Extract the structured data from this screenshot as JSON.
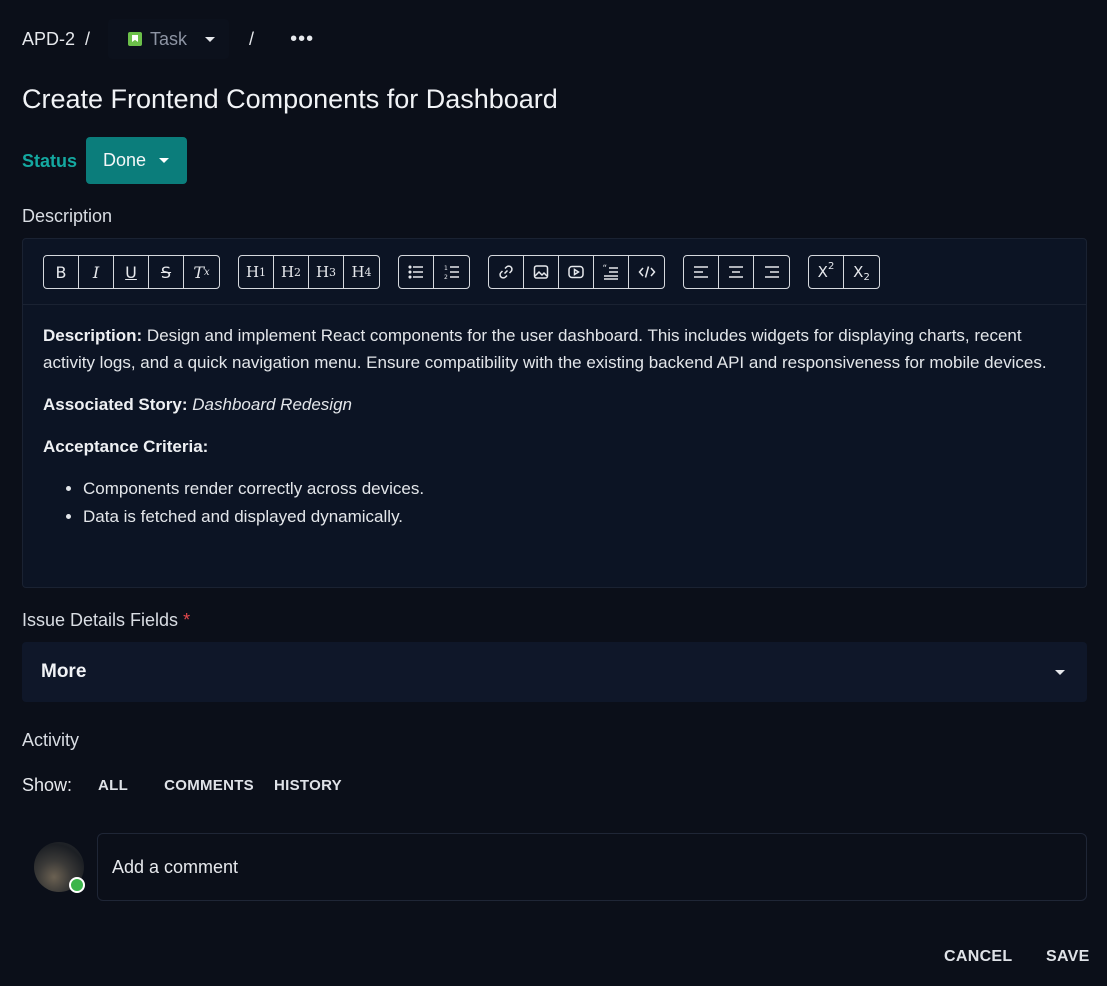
{
  "breadcrumb": {
    "issue_key": "APD-2",
    "separator": "/",
    "issue_type": "Task",
    "more_icon": "more-horizontal-icon"
  },
  "issue": {
    "title": "Create Frontend Components for Dashboard",
    "status_label": "Status",
    "status_value": "Done"
  },
  "description": {
    "label": "Description",
    "toolbar": {
      "formatting": [
        "bold",
        "italic",
        "underline",
        "strikethrough",
        "clear-format"
      ],
      "headings": [
        "H1",
        "H2",
        "H3",
        "H4"
      ],
      "lists": [
        "bullet-list",
        "ordered-list"
      ],
      "insert": [
        "link",
        "image",
        "video",
        "blockquote",
        "code"
      ],
      "align": [
        "align-left",
        "align-center",
        "align-right"
      ],
      "script": [
        "superscript",
        "subscript"
      ]
    },
    "body": {
      "desc_label": "Description:",
      "desc_text": " Design and implement React components for the user dashboard. This includes widgets for displaying charts, recent activity logs, and a quick navigation menu. Ensure compatibility with the existing backend API and responsiveness for mobile devices.",
      "story_label": "Associated Story:",
      "story_value": "Dashboard Redesign",
      "criteria_label": "Acceptance Criteria:",
      "criteria": [
        "Components render correctly across devices.",
        "Data is fetched and displayed dynamically."
      ]
    }
  },
  "details": {
    "label": "Issue Details Fields",
    "required_marker": "*",
    "more_label": "More"
  },
  "activity": {
    "label": "Activity",
    "show_label": "Show:",
    "filters": [
      "ALL",
      "COMMENTS",
      "HISTORY"
    ],
    "comment_placeholder": "Add a comment"
  },
  "actions": {
    "cancel": "CANCEL",
    "save": "SAVE"
  },
  "colors": {
    "background": "#0b0f19",
    "accent_teal": "#0b7d7b",
    "status_label": "#14a8a0",
    "required": "#e5484d",
    "online": "#3bb54a",
    "task_icon": "#6cc04a"
  }
}
